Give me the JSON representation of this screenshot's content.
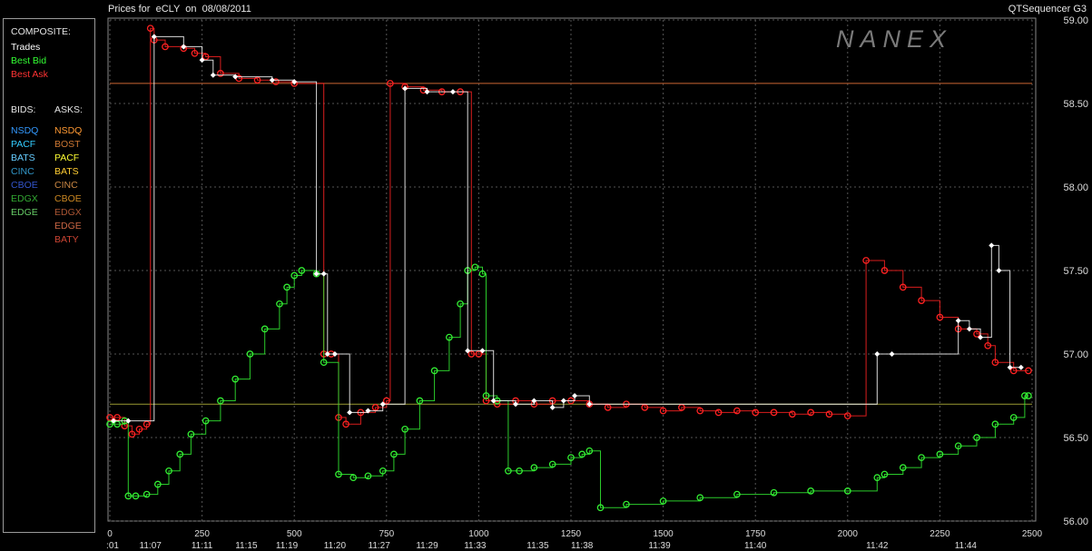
{
  "header": {
    "title_prefix": "Prices for",
    "symbol": "eCLY",
    "on_label": "on",
    "date": "08/08/2011",
    "app_name": "QTSequencer G3",
    "watermark": "NANEX"
  },
  "legend": {
    "composite_label": "COMPOSITE:",
    "composite_items": [
      {
        "label": "Trades",
        "color": "#ffffff"
      },
      {
        "label": "Best Bid",
        "color": "#33ff33"
      },
      {
        "label": "Best Ask",
        "color": "#ff3333"
      }
    ],
    "bids_label": "BIDS:",
    "asks_label": "ASKS:",
    "bids": [
      {
        "label": "NSDQ",
        "color": "#3399ff"
      },
      {
        "label": "PACF",
        "color": "#33ccff"
      },
      {
        "label": "BATS",
        "color": "#66ccff"
      },
      {
        "label": "CINC",
        "color": "#3399cc"
      },
      {
        "label": "CBOE",
        "color": "#3355cc"
      },
      {
        "label": "EDGX",
        "color": "#33aa33"
      },
      {
        "label": "EDGE",
        "color": "#66cc66"
      }
    ],
    "asks": [
      {
        "label": "NSDQ",
        "color": "#ff9933"
      },
      {
        "label": "BOST",
        "color": "#cc7733"
      },
      {
        "label": "PACF",
        "color": "#ffff33"
      },
      {
        "label": "BATS",
        "color": "#ffcc33"
      },
      {
        "label": "CINC",
        "color": "#cc8844"
      },
      {
        "label": "CBOE",
        "color": "#cc8822"
      },
      {
        "label": "EDGX",
        "color": "#aa5533"
      },
      {
        "label": "EDGE",
        "color": "#cc6644"
      },
      {
        "label": "BATY",
        "color": "#cc4433"
      }
    ]
  },
  "chart_data": {
    "type": "line",
    "xlim": [
      0,
      2500
    ],
    "ylim": [
      56.0,
      59.0
    ],
    "grid": true,
    "x_ticks": [
      "0",
      "250",
      "500",
      "750",
      "1000",
      "1250",
      "1500",
      "1750",
      "2000",
      "2250",
      "2500"
    ],
    "y_ticks": [
      "56.00",
      "56.50",
      "57.00",
      "57.50",
      "58.00",
      "58.50",
      "59.00"
    ],
    "time_labels": [
      {
        "x": 0,
        "label": ":01"
      },
      {
        "x": 110,
        "label": "11:07"
      },
      {
        "x": 250,
        "label": "11:11"
      },
      {
        "x": 370,
        "label": "11:15"
      },
      {
        "x": 480,
        "label": "11:19"
      },
      {
        "x": 610,
        "label": "11:20"
      },
      {
        "x": 730,
        "label": "11:27"
      },
      {
        "x": 860,
        "label": "11:29"
      },
      {
        "x": 990,
        "label": "11:33"
      },
      {
        "x": 1160,
        "label": "11:35"
      },
      {
        "x": 1280,
        "label": "11:38"
      },
      {
        "x": 1490,
        "label": "11:39"
      },
      {
        "x": 1750,
        "label": "11:40"
      },
      {
        "x": 2080,
        "label": "11:42"
      },
      {
        "x": 2320,
        "label": "11:44"
      }
    ],
    "reference_levels": [
      {
        "y": 58.62,
        "color": "#cc6633"
      },
      {
        "y": 56.7,
        "color": "#999933"
      }
    ],
    "series": [
      {
        "name": "Best Ask",
        "color": "#ff2222",
        "marker": "circle",
        "points": [
          [
            0,
            56.62
          ],
          [
            20,
            56.62
          ],
          [
            40,
            56.57
          ],
          [
            60,
            56.52
          ],
          [
            80,
            56.55
          ],
          [
            100,
            56.58
          ],
          [
            110,
            58.95
          ],
          [
            120,
            58.88
          ],
          [
            150,
            58.84
          ],
          [
            200,
            58.83
          ],
          [
            230,
            58.8
          ],
          [
            260,
            58.78
          ],
          [
            300,
            58.68
          ],
          [
            350,
            58.65
          ],
          [
            400,
            58.64
          ],
          [
            450,
            58.63
          ],
          [
            500,
            58.62
          ],
          [
            580,
            57.0
          ],
          [
            600,
            57.0
          ],
          [
            620,
            56.62
          ],
          [
            640,
            56.58
          ],
          [
            680,
            56.65
          ],
          [
            720,
            56.68
          ],
          [
            750,
            56.72
          ],
          [
            760,
            58.62
          ],
          [
            800,
            58.6
          ],
          [
            850,
            58.58
          ],
          [
            900,
            58.57
          ],
          [
            950,
            58.57
          ],
          [
            980,
            57.0
          ],
          [
            1000,
            57.0
          ],
          [
            1020,
            56.72
          ],
          [
            1050,
            56.7
          ],
          [
            1100,
            56.72
          ],
          [
            1150,
            56.7
          ],
          [
            1200,
            56.72
          ],
          [
            1250,
            56.72
          ],
          [
            1300,
            56.7
          ],
          [
            1350,
            56.68
          ],
          [
            1400,
            56.7
          ],
          [
            1450,
            56.68
          ],
          [
            1500,
            56.66
          ],
          [
            1550,
            56.68
          ],
          [
            1600,
            56.66
          ],
          [
            1650,
            56.65
          ],
          [
            1700,
            56.66
          ],
          [
            1750,
            56.65
          ],
          [
            1800,
            56.65
          ],
          [
            1850,
            56.64
          ],
          [
            1900,
            56.65
          ],
          [
            1950,
            56.64
          ],
          [
            2000,
            56.63
          ],
          [
            2050,
            57.56
          ],
          [
            2100,
            57.5
          ],
          [
            2150,
            57.4
          ],
          [
            2200,
            57.32
          ],
          [
            2250,
            57.22
          ],
          [
            2300,
            57.15
          ],
          [
            2350,
            57.12
          ],
          [
            2380,
            57.05
          ],
          [
            2400,
            56.95
          ],
          [
            2450,
            56.9
          ],
          [
            2490,
            56.9
          ]
        ]
      },
      {
        "name": "Best Bid",
        "color": "#33ee33",
        "marker": "circle",
        "points": [
          [
            0,
            56.58
          ],
          [
            20,
            56.58
          ],
          [
            40,
            56.6
          ],
          [
            50,
            56.15
          ],
          [
            70,
            56.15
          ],
          [
            100,
            56.16
          ],
          [
            130,
            56.22
          ],
          [
            160,
            56.3
          ],
          [
            190,
            56.4
          ],
          [
            220,
            56.52
          ],
          [
            260,
            56.6
          ],
          [
            300,
            56.72
          ],
          [
            340,
            56.85
          ],
          [
            380,
            57.0
          ],
          [
            420,
            57.15
          ],
          [
            460,
            57.3
          ],
          [
            480,
            57.4
          ],
          [
            500,
            57.47
          ],
          [
            520,
            57.5
          ],
          [
            560,
            57.48
          ],
          [
            580,
            56.95
          ],
          [
            620,
            56.28
          ],
          [
            660,
            56.26
          ],
          [
            700,
            56.27
          ],
          [
            740,
            56.3
          ],
          [
            770,
            56.4
          ],
          [
            800,
            56.55
          ],
          [
            840,
            56.72
          ],
          [
            880,
            56.9
          ],
          [
            920,
            57.1
          ],
          [
            950,
            57.3
          ],
          [
            970,
            57.5
          ],
          [
            990,
            57.52
          ],
          [
            1010,
            57.48
          ],
          [
            1020,
            56.75
          ],
          [
            1050,
            56.72
          ],
          [
            1080,
            56.3
          ],
          [
            1110,
            56.3
          ],
          [
            1150,
            56.32
          ],
          [
            1200,
            56.34
          ],
          [
            1250,
            56.38
          ],
          [
            1280,
            56.4
          ],
          [
            1300,
            56.42
          ],
          [
            1330,
            56.08
          ],
          [
            1400,
            56.1
          ],
          [
            1500,
            56.12
          ],
          [
            1600,
            56.14
          ],
          [
            1700,
            56.16
          ],
          [
            1800,
            56.17
          ],
          [
            1900,
            56.18
          ],
          [
            2000,
            56.18
          ],
          [
            2080,
            56.26
          ],
          [
            2100,
            56.28
          ],
          [
            2150,
            56.32
          ],
          [
            2200,
            56.38
          ],
          [
            2250,
            56.4
          ],
          [
            2300,
            56.45
          ],
          [
            2350,
            56.5
          ],
          [
            2400,
            56.58
          ],
          [
            2450,
            56.62
          ],
          [
            2480,
            56.75
          ],
          [
            2490,
            56.75
          ]
        ]
      },
      {
        "name": "Trades",
        "color": "#ffffff",
        "marker": "diamond",
        "points": [
          [
            10,
            56.6
          ],
          [
            50,
            56.6
          ],
          [
            120,
            58.9
          ],
          [
            200,
            58.84
          ],
          [
            250,
            58.76
          ],
          [
            280,
            58.67
          ],
          [
            340,
            58.66
          ],
          [
            440,
            58.64
          ],
          [
            500,
            58.63
          ],
          [
            560,
            57.48
          ],
          [
            580,
            57.48
          ],
          [
            590,
            57.0
          ],
          [
            610,
            57.0
          ],
          [
            650,
            56.65
          ],
          [
            700,
            56.66
          ],
          [
            740,
            56.7
          ],
          [
            800,
            58.59
          ],
          [
            860,
            58.57
          ],
          [
            930,
            58.57
          ],
          [
            970,
            57.02
          ],
          [
            1010,
            57.02
          ],
          [
            1040,
            56.72
          ],
          [
            1100,
            56.7
          ],
          [
            1150,
            56.72
          ],
          [
            1200,
            56.68
          ],
          [
            1230,
            56.72
          ],
          [
            1260,
            56.75
          ],
          [
            1300,
            56.7
          ],
          [
            2080,
            57.0
          ],
          [
            2120,
            57.0
          ],
          [
            2300,
            57.2
          ],
          [
            2330,
            57.15
          ],
          [
            2360,
            57.1
          ],
          [
            2390,
            57.65
          ],
          [
            2410,
            57.5
          ],
          [
            2440,
            56.92
          ],
          [
            2470,
            56.92
          ]
        ]
      }
    ]
  }
}
